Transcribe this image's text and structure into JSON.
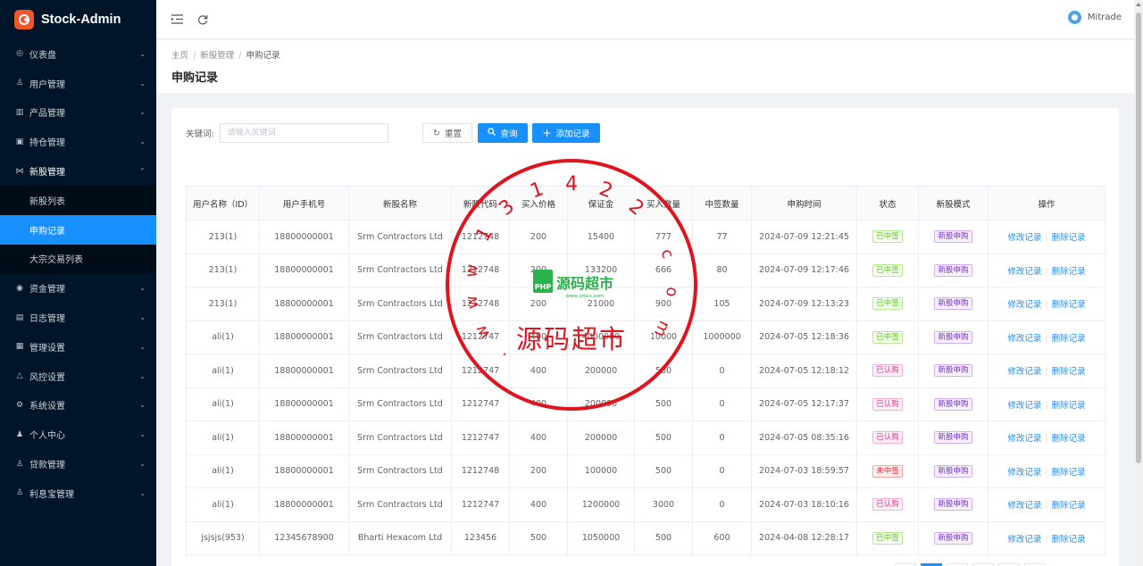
{
  "app": {
    "name": "Stock-Admin"
  },
  "sidebar": {
    "items": [
      {
        "label": "仪表盘",
        "icon": "dashboard-icon",
        "glyph": "◎"
      },
      {
        "label": "用户管理",
        "icon": "users-icon",
        "glyph": "♙"
      },
      {
        "label": "产品管理",
        "icon": "chart-icon",
        "glyph": "▥"
      },
      {
        "label": "持仓管理",
        "icon": "position-icon",
        "glyph": "▣"
      },
      {
        "label": "新股管理",
        "icon": "ipo-icon",
        "glyph": "⋈",
        "open": true,
        "children": [
          {
            "label": "新股列表"
          },
          {
            "label": "申购记录",
            "active": true
          },
          {
            "label": "大宗交易列表"
          }
        ]
      },
      {
        "label": "资金管理",
        "icon": "money-icon",
        "glyph": "◉"
      },
      {
        "label": "日志管理",
        "icon": "log-icon",
        "glyph": "▤"
      },
      {
        "label": "管理设置",
        "icon": "admin-settings-icon",
        "glyph": "▦"
      },
      {
        "label": "风控设置",
        "icon": "warning-icon",
        "glyph": "△"
      },
      {
        "label": "系统设置",
        "icon": "gear-icon",
        "glyph": "⚙"
      },
      {
        "label": "个人中心",
        "icon": "person-icon",
        "glyph": "♟"
      },
      {
        "label": "贷款管理",
        "icon": "loan-icon",
        "glyph": "♙"
      },
      {
        "label": "利息宝管理",
        "icon": "interest-icon",
        "glyph": "♙"
      }
    ]
  },
  "header": {
    "user": "Mitrade"
  },
  "breadcrumb": [
    "主页",
    "新股管理",
    "申购记录"
  ],
  "page": {
    "title": "申购记录"
  },
  "search": {
    "label": "关键词:",
    "placeholder": "请输入关键词",
    "reset_label": "重置",
    "query_label": "查询",
    "add_label": "添加记录"
  },
  "table": {
    "columns": [
      "用户名称（ID）",
      "用户手机号",
      "新股名称",
      "新股代码",
      "买入价格",
      "保证金",
      "买入数量",
      "中签数量",
      "申购时间",
      "状态",
      "新股模式",
      "操作"
    ],
    "edit_label": "修改记录",
    "delete_label": "删除记录",
    "rows": [
      {
        "user": "213(1)",
        "phone": "18800000001",
        "name": "Srm Contractors Ltd",
        "code": "1212748",
        "price": "200",
        "margin": "15400",
        "qty": "777",
        "won": "77",
        "time": "2024-07-09 12:21:45",
        "status": "已中签",
        "status_color": "green",
        "mode": "新股申购"
      },
      {
        "user": "213(1)",
        "phone": "18800000001",
        "name": "Srm Contractors Ltd",
        "code": "1212748",
        "price": "200",
        "margin": "133200",
        "qty": "666",
        "won": "80",
        "time": "2024-07-09 12:17:46",
        "status": "已中签",
        "status_color": "green",
        "mode": "新股申购"
      },
      {
        "user": "213(1)",
        "phone": "18800000001",
        "name": "Srm Contractors Ltd",
        "code": "1212748",
        "price": "200",
        "margin": "21000",
        "qty": "900",
        "won": "105",
        "time": "2024-07-09 12:13:23",
        "status": "已中签",
        "status_color": "green",
        "mode": "新股申购"
      },
      {
        "user": "ali(1)",
        "phone": "18800000001",
        "name": "Srm Contractors Ltd",
        "code": "1212747",
        "price": "400",
        "margin": "4000000",
        "qty": "10000",
        "won": "1000000",
        "time": "2024-07-05 12:18:36",
        "status": "已中签",
        "status_color": "green",
        "mode": "新股申购"
      },
      {
        "user": "ali(1)",
        "phone": "18800000001",
        "name": "Srm Contractors Ltd",
        "code": "1212747",
        "price": "400",
        "margin": "200000",
        "qty": "500",
        "won": "0",
        "time": "2024-07-05 12:18:12",
        "status": "已认购",
        "status_color": "magenta",
        "mode": "新股申购"
      },
      {
        "user": "ali(1)",
        "phone": "18800000001",
        "name": "Srm Contractors Ltd",
        "code": "1212747",
        "price": "400",
        "margin": "200000",
        "qty": "500",
        "won": "0",
        "time": "2024-07-05 12:17:37",
        "status": "已认购",
        "status_color": "magenta",
        "mode": "新股申购"
      },
      {
        "user": "ali(1)",
        "phone": "18800000001",
        "name": "Srm Contractors Ltd",
        "code": "1212747",
        "price": "400",
        "margin": "200000",
        "qty": "500",
        "won": "0",
        "time": "2024-07-05 08:35:16",
        "status": "已认购",
        "status_color": "magenta",
        "mode": "新股申购"
      },
      {
        "user": "ali(1)",
        "phone": "18800000001",
        "name": "Srm Contractors Ltd",
        "code": "1212748",
        "price": "200",
        "margin": "100000",
        "qty": "500",
        "won": "0",
        "time": "2024-07-03 18:59:57",
        "status": "未中签",
        "status_color": "red",
        "mode": "新股申购"
      },
      {
        "user": "ali(1)",
        "phone": "18800000001",
        "name": "Srm Contractors Ltd",
        "code": "1212747",
        "price": "400",
        "margin": "1200000",
        "qty": "3000",
        "won": "0",
        "time": "2024-07-03 18:10:16",
        "status": "已认购",
        "status_color": "magenta",
        "mode": "新股申购"
      },
      {
        "user": "jsjsjs(953)",
        "phone": "12345678900",
        "name": "Bharti Hexacom Ltd",
        "code": "123456",
        "price": "500",
        "margin": "1050000",
        "qty": "500",
        "won": "600",
        "time": "2024-04-08 12:28:17",
        "status": "已中签",
        "status_color": "green",
        "mode": "新股申购"
      }
    ]
  },
  "watermark": {
    "numbers": "131422",
    "url_prefix": "www.",
    "url_suffix": "com",
    "text": "源码超市",
    "logo_main": "源码超市",
    "logo_sub": "www.ymcs.com",
    "logo_badge": "PHP",
    "colors": {
      "ring": "#e0141e",
      "logo": "#2bb24c"
    }
  },
  "colors": {
    "sidebar": "#001529",
    "primary": "#1890ff"
  }
}
